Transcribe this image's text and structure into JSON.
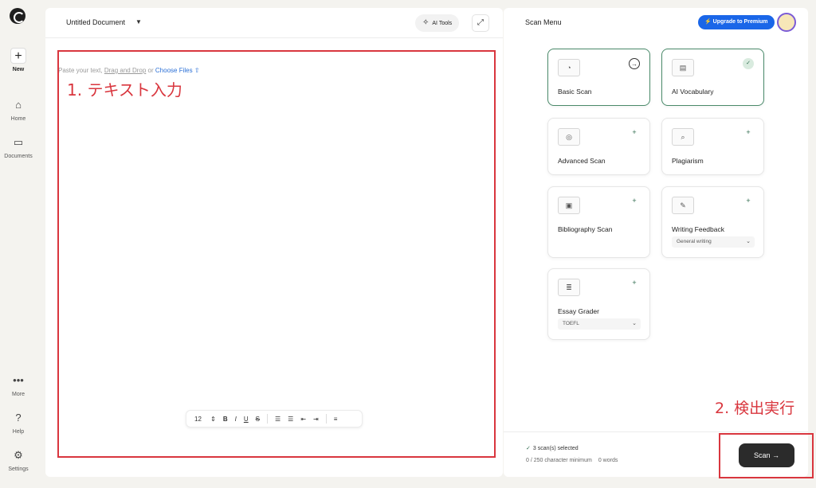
{
  "sidebar": {
    "new_label": "New",
    "items": [
      {
        "label": "Home"
      },
      {
        "label": "Documents"
      },
      {
        "label": "More"
      },
      {
        "label": "Help"
      },
      {
        "label": "Settings"
      }
    ]
  },
  "editor": {
    "doc_title": "Untitled Document",
    "ai_tools_label": "AI Tools",
    "placeholder_prefix": "Paste your text,",
    "placeholder_dd": "Drag and Drop",
    "placeholder_or": "or",
    "placeholder_choose": "Choose Files",
    "toolbar": {
      "font_size": "12",
      "bold": "B",
      "italic": "I",
      "underline": "U",
      "strike": "S"
    }
  },
  "annotations": {
    "step1": "1. テキスト入力",
    "step2": "2. 検出実行",
    "color": "#d9363e"
  },
  "scan_panel": {
    "title": "Scan Menu",
    "upgrade_label": "Upgrade to Premium",
    "cards": [
      {
        "name": "Basic Scan",
        "state": "selected-arrow"
      },
      {
        "name": "AI Vocabulary",
        "state": "selected-check"
      },
      {
        "name": "Advanced Scan",
        "state": "add"
      },
      {
        "name": "Plagiarism",
        "state": "add"
      },
      {
        "name": "Bibliography Scan",
        "state": "add"
      },
      {
        "name": "Writing Feedback",
        "state": "add",
        "option": "General writing"
      },
      {
        "name": "Essay Grader",
        "state": "add",
        "option": "TOEFL"
      }
    ],
    "selected_count": "3 scan(s) selected",
    "char_count": "0 / 250 character minimum",
    "word_count": "0 words",
    "scan_label": "Scan"
  },
  "colors": {
    "accent": "#1a66e8",
    "selected_border": "#4a8a6a",
    "scan_button": "#2b2b2b"
  }
}
